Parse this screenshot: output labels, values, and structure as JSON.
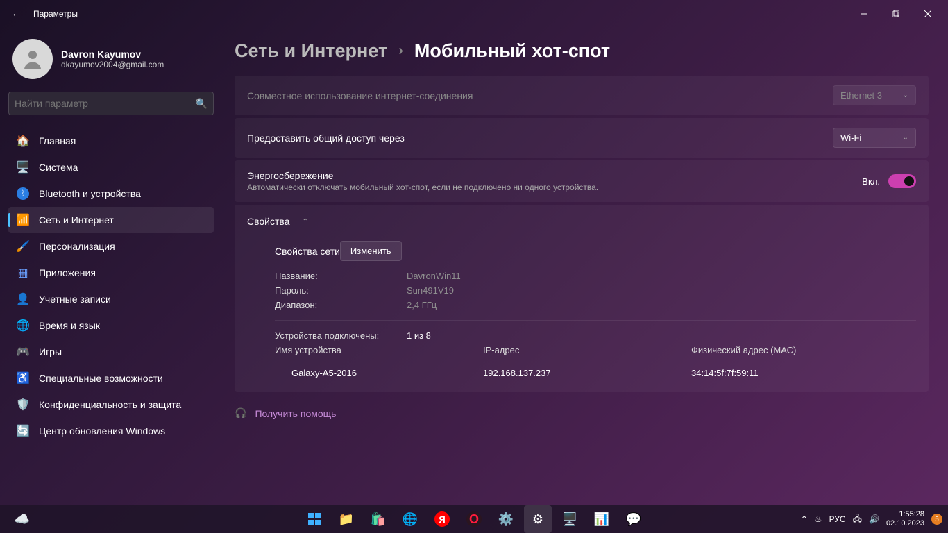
{
  "window": {
    "app_title": "Параметры"
  },
  "user": {
    "name": "Davron Kayumov",
    "email": "dkayumov2004@gmail.com"
  },
  "search": {
    "placeholder": "Найти параметр"
  },
  "nav": {
    "items": [
      {
        "label": "Главная"
      },
      {
        "label": "Система"
      },
      {
        "label": "Bluetooth и устройства"
      },
      {
        "label": "Сеть и Интернет"
      },
      {
        "label": "Персонализация"
      },
      {
        "label": "Приложения"
      },
      {
        "label": "Учетные записи"
      },
      {
        "label": "Время и язык"
      },
      {
        "label": "Игры"
      },
      {
        "label": "Специальные возможности"
      },
      {
        "label": "Конфиденциальность и защита"
      },
      {
        "label": "Центр обновления Windows"
      }
    ]
  },
  "breadcrumb": {
    "parent": "Сеть и Интернет",
    "current": "Мобильный хот-спот"
  },
  "settings": {
    "share_conn": {
      "label": "Совместное использование интернет-соединения",
      "value": "Ethernet 3"
    },
    "share_over": {
      "label": "Предоставить общий доступ через",
      "value": "Wi-Fi"
    },
    "power": {
      "label": "Энергосбережение",
      "sub": "Автоматически отключать мобильный хот-спот, если не подключено ни одного устройства.",
      "state_label": "Вкл."
    },
    "props": {
      "header": "Свойства",
      "net_header": "Свойства сети",
      "edit_btn": "Изменить",
      "name_k": "Название:",
      "name_v": "DavronWin11",
      "pass_k": "Пароль:",
      "pass_v": "Sun491V19",
      "band_k": "Диапазон:",
      "band_v": "2,4 ГГц",
      "devs_k": "Устройства подключены:",
      "devs_v": "1 из 8",
      "col_name": "Имя устройства",
      "col_ip": "IP-адрес",
      "col_mac": "Физический адрес (МАС)",
      "devices": [
        {
          "name": "Galaxy-A5-2016",
          "ip": "192.168.137.237",
          "mac": "34:14:5f:7f:59:11"
        }
      ]
    }
  },
  "help": {
    "label": "Получить помощь"
  },
  "tray": {
    "lang": "РУС",
    "time": "1:55:28",
    "date": "02.10.2023",
    "notif": "5"
  }
}
